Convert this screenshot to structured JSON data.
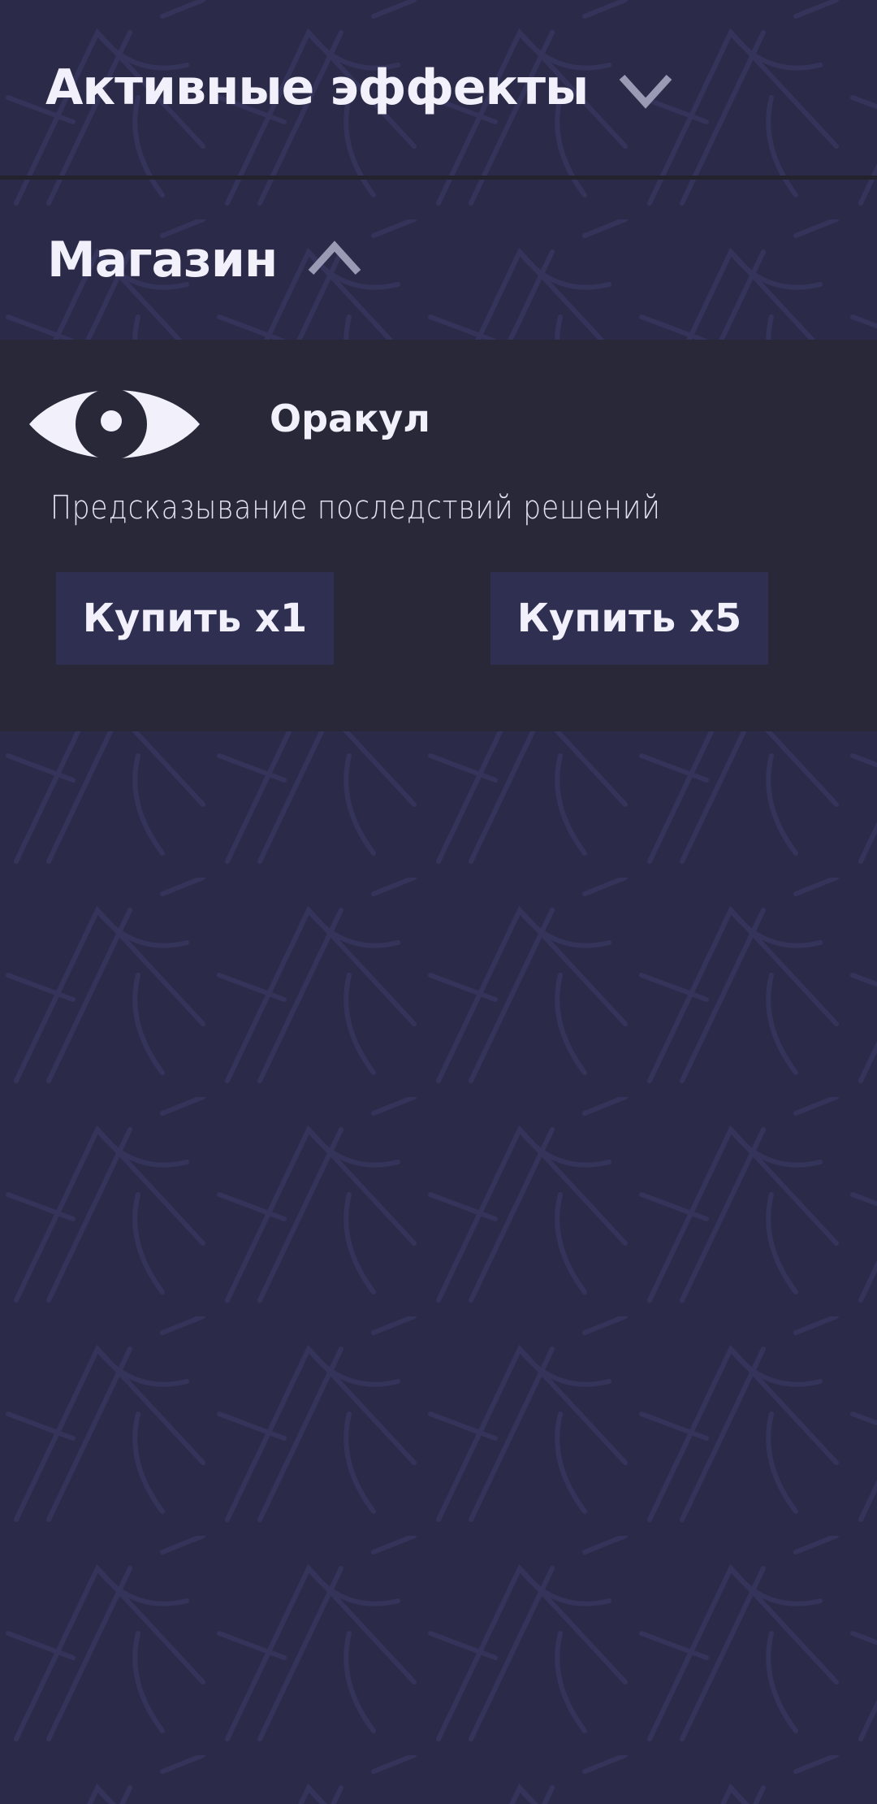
{
  "colors": {
    "background": "#2b2a48",
    "pattern": "#34335a",
    "divider": "#23232e",
    "panel": "#282838",
    "button": "#2f2f52",
    "text": "#f1f0fb",
    "chevron": "#9b9ab4"
  },
  "sections": {
    "active_effects": {
      "title": "Активные эффекты",
      "icon": "chevron-down-icon",
      "expanded": false
    },
    "shop": {
      "title": "Магазин",
      "icon": "chevron-up-icon",
      "expanded": true
    }
  },
  "shop_item": {
    "icon": "eye-icon",
    "name": "Оракул",
    "description": "Предсказывание последствий решений",
    "buy_one_label": "Купить x1",
    "buy_five_label": "Купить x5"
  }
}
